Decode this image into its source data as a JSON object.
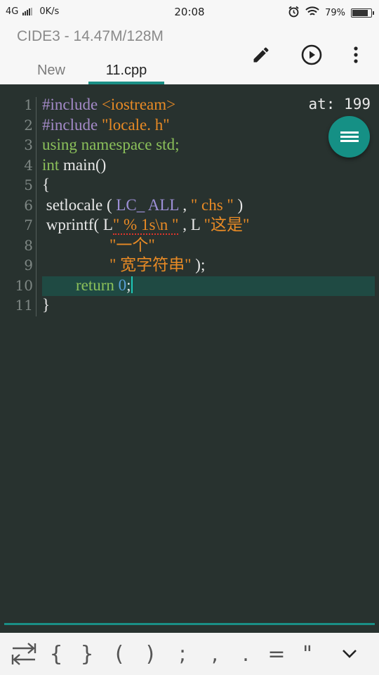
{
  "status": {
    "network": "4G",
    "speed": "0K/s",
    "time": "20:08",
    "battery": "79%",
    "battery_level": 0.79
  },
  "app": {
    "title": "CIDE3 - 14.47M/128M",
    "actions": [
      "edit-icon",
      "run-icon",
      "more-icon"
    ],
    "tabs": [
      {
        "label": "New",
        "active": false
      },
      {
        "label": "11.cpp",
        "active": true
      }
    ],
    "accent": "#1a8f86"
  },
  "editor": {
    "position_label": "at: 199",
    "current_line": 10,
    "lines": [
      {
        "num": "1",
        "text": "#include <iostream>"
      },
      {
        "num": "2",
        "text": "#include \"locale. h\""
      },
      {
        "num": "3",
        "text": "using namespace std;"
      },
      {
        "num": "4",
        "text": "int main()"
      },
      {
        "num": "5",
        "text": "{"
      },
      {
        "num": "6",
        "text": "  setlocale ( LC_ ALL , \" chs \" )"
      },
      {
        "num": "7",
        "text": "  wprintf( L\" % 1s\\n \" , L \"这是\""
      },
      {
        "num": "8",
        "text": "            \"一个\""
      },
      {
        "num": "9",
        "text": "            \" 宽字符串\" );"
      },
      {
        "num": "10",
        "text": "        return 0;"
      },
      {
        "num": "11",
        "text": "}"
      }
    ],
    "tokens": {
      "l1a": "#include",
      "l1b": " <iostream>",
      "l2a": "#include",
      "l2b": " \"locale. h\"",
      "l3": "using namespace std;",
      "l4a": "int",
      "l4b": " main()",
      "l5": "{",
      "l6a": " setlocale ( ",
      "l6b": "LC_ ALL",
      "l6c": " , ",
      "l6d": "\" chs \"",
      "l6e": " )",
      "l7a": " wprintf( L",
      "l7b": "\" % 1s\\n \"",
      "l7c": " , L ",
      "l7d": "\"这是\"",
      "l8": "\"一个\"",
      "l9a": "\" 宽字符串\"",
      "l9b": " );",
      "l10a": "return",
      "l10b": " 0",
      "l10c": ";",
      "l11": "}"
    }
  },
  "symbols": [
    "⇄",
    "{",
    "}",
    "(",
    ")",
    ";",
    ",",
    ".",
    "=",
    "\"",
    "⌄"
  ]
}
